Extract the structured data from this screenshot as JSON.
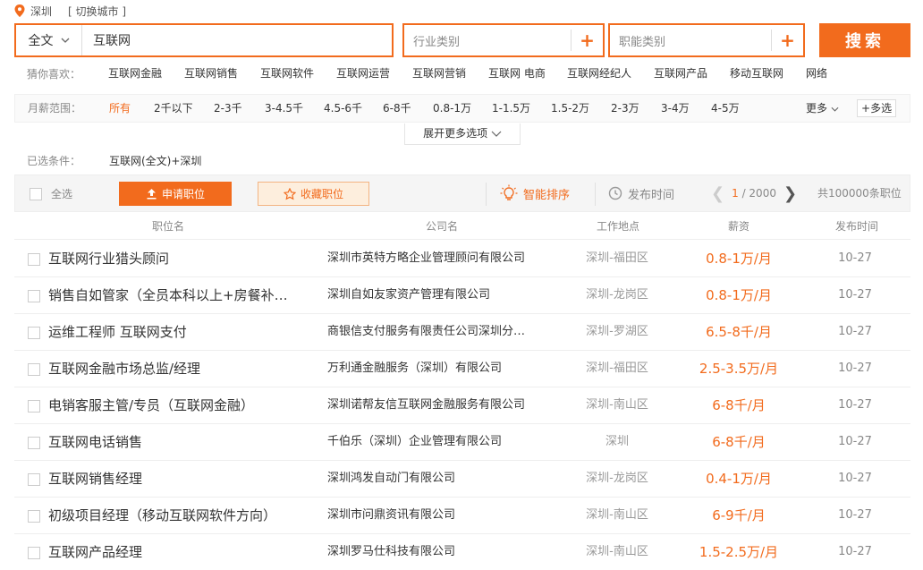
{
  "location": {
    "city": "深圳",
    "switch_label": "[ 切换城市 ]"
  },
  "search": {
    "scope": "全文",
    "keyword": "互联网",
    "industry_placeholder": "行业类别",
    "function_placeholder": "职能类别",
    "button_label": "搜索"
  },
  "guess": {
    "label": "猜你喜欢：",
    "items": [
      "互联网金融",
      "互联网销售",
      "互联网软件",
      "互联网运营",
      "互联网营销",
      "互联网 电商",
      "互联网经纪人",
      "互联网产品",
      "移动互联网",
      "网络"
    ]
  },
  "salary": {
    "label": "月薪范围：",
    "items": [
      "所有",
      "2千以下",
      "2-3千",
      "3-4.5千",
      "4.5-6千",
      "6-8千",
      "0.8-1万",
      "1-1.5万",
      "1.5-2万",
      "2-3万",
      "3-4万",
      "4-5万"
    ],
    "more_label": "更多",
    "multi_label": "多选"
  },
  "expand_label": "展开更多选项",
  "conditions": {
    "label": "已选条件：",
    "value": "互联网(全文)+深圳"
  },
  "toolbar": {
    "select_all": "全选",
    "apply": "申请职位",
    "favorite": "收藏职位",
    "smart_sort": "智能排序",
    "pub_time": "发布时间",
    "page_current": "1",
    "page_total": "/ 2000",
    "count": "共100000条职位"
  },
  "table": {
    "headers": [
      "职位名",
      "公司名",
      "工作地点",
      "薪资",
      "发布时间"
    ],
    "rows": [
      {
        "title": "互联网行业猎头顾问",
        "company": "深圳市英特方略企业管理顾问有限公司",
        "location": "深圳-福田区",
        "salary": "0.8-1万/月",
        "date": "10-27"
      },
      {
        "title": "销售自如管家（全员本科以上+房餐补…",
        "company": "深圳自如友家资产管理有限公司",
        "location": "深圳-龙岗区",
        "salary": "0.8-1万/月",
        "date": "10-27"
      },
      {
        "title": "运维工程师 互联网支付",
        "company": "商银信支付服务有限责任公司深圳分…",
        "location": "深圳-罗湖区",
        "salary": "6.5-8千/月",
        "date": "10-27"
      },
      {
        "title": "互联网金融市场总监/经理",
        "company": "万利通金融服务（深圳）有限公司",
        "location": "深圳-福田区",
        "salary": "2.5-3.5万/月",
        "date": "10-27"
      },
      {
        "title": "电销客服主管/专员（互联网金融）",
        "company": "深圳诺帮友信互联网金融服务有限公司",
        "location": "深圳-南山区",
        "salary": "6-8千/月",
        "date": "10-27"
      },
      {
        "title": "互联网电话销售",
        "company": "千伯乐（深圳）企业管理有限公司",
        "location": "深圳",
        "salary": "6-8千/月",
        "date": "10-27"
      },
      {
        "title": "互联网销售经理",
        "company": "深圳鸿发自动门有限公司",
        "location": "深圳-龙岗区",
        "salary": "0.4-1万/月",
        "date": "10-27"
      },
      {
        "title": "初级项目经理（移动互联网软件方向）",
        "company": "深圳市问鼎资讯有限公司",
        "location": "深圳-南山区",
        "salary": "6-9千/月",
        "date": "10-27"
      },
      {
        "title": "互联网产品经理",
        "company": "深圳罗马仕科技有限公司",
        "location": "深圳-南山区",
        "salary": "1.5-2.5万/月",
        "date": "10-27"
      }
    ]
  },
  "colors": {
    "accent": "#f26b1d",
    "muted": "#888888"
  }
}
